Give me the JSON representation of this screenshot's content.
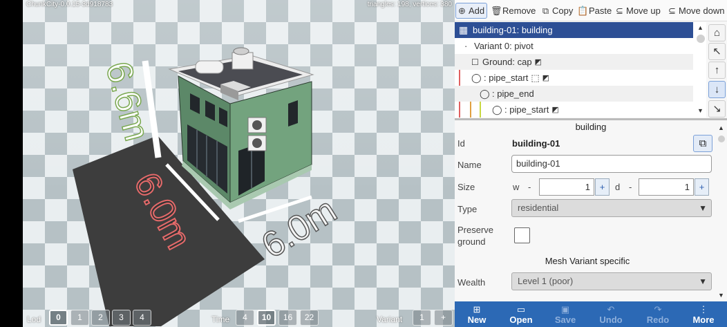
{
  "viewport": {
    "version": "ChunkCity-0.0.15-3d918783",
    "stats": "triangles: 198, vertices: 380",
    "dimensions": {
      "height": "6.6m",
      "width": "6.0m",
      "depth": "6.0m"
    },
    "lod": {
      "label": "Lod",
      "options": [
        "0",
        "1",
        "2",
        "3",
        "4"
      ],
      "selected": "0"
    },
    "time": {
      "label": "Time",
      "options": [
        "4",
        "10",
        "16",
        "22"
      ],
      "selected": "10"
    },
    "variant": {
      "label": "Variant",
      "value": "1",
      "plus": "+"
    }
  },
  "toolbar": {
    "add": "Add",
    "remove": "Remove",
    "copy": "Copy",
    "paste": "Paste",
    "move_up": "Move up",
    "move_down": "Move down"
  },
  "tree": {
    "rows": [
      {
        "label": "building-01: building",
        "selected": true
      },
      {
        "label": "Variant 0: pivot"
      },
      {
        "label": "Ground: cap"
      },
      {
        "label": ": pipe_start"
      },
      {
        "label": ": pipe_end"
      },
      {
        "label": ": pipe_start"
      }
    ]
  },
  "properties": {
    "section_title": "building",
    "id_label": "Id",
    "id_value": "building-01",
    "name_label": "Name",
    "name_value": "building-01",
    "size_label": "Size",
    "w_label": "w",
    "w_value": "1",
    "d_label": "d",
    "d_value": "1",
    "minus": "-",
    "plus": "+",
    "type_label": "Type",
    "type_value": "residential",
    "preserve_label_1": "Preserve",
    "preserve_label_2": "ground",
    "preserve_checked": false,
    "mesh_variant_title": "Mesh Variant specific",
    "wealth_label": "Wealth",
    "wealth_value": "Level 1 (poor)"
  },
  "actions": {
    "new": "New",
    "open": "Open",
    "save": "Save",
    "undo": "Undo",
    "redo": "Redo",
    "more": "More"
  },
  "colors": {
    "accent": "#2c69b5",
    "selection": "#2d4f95",
    "building_wall": "#5f8a6a"
  }
}
